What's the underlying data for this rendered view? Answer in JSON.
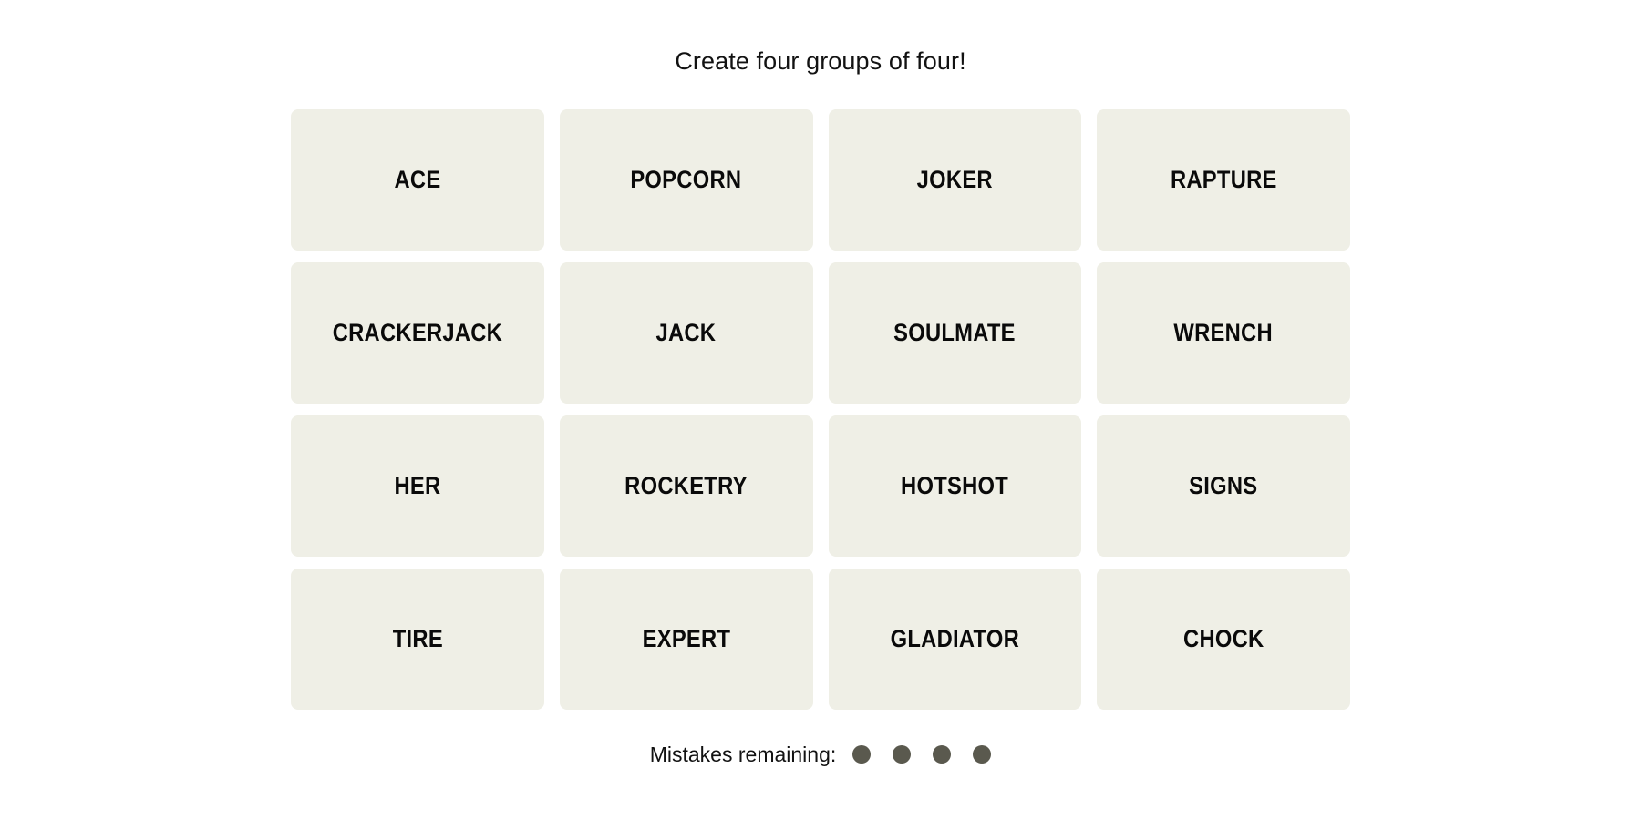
{
  "game": {
    "instruction": "Create four groups of four!",
    "tile_bg_color": "#EFEFE6",
    "tile_text_color": "#0A0A0A",
    "page_bg_color": "#FFFFFF",
    "grid": {
      "rows": 4,
      "columns": 4,
      "tiles": [
        {
          "label": "ACE"
        },
        {
          "label": "POPCORN"
        },
        {
          "label": "JOKER"
        },
        {
          "label": "RAPTURE"
        },
        {
          "label": "CRACKERJACK"
        },
        {
          "label": "JACK"
        },
        {
          "label": "SOULMATE"
        },
        {
          "label": "WRENCH"
        },
        {
          "label": "HER"
        },
        {
          "label": "ROCKETRY"
        },
        {
          "label": "HOTSHOT"
        },
        {
          "label": "SIGNS"
        },
        {
          "label": "TIRE"
        },
        {
          "label": "EXPERT"
        },
        {
          "label": "GLADIATOR"
        },
        {
          "label": "CHOCK"
        }
      ]
    },
    "mistakes": {
      "label": "Mistakes remaining:",
      "remaining": 4,
      "dot_color": "#5A594E",
      "dots": [
        {
          "filled": true
        },
        {
          "filled": true
        },
        {
          "filled": true
        },
        {
          "filled": true
        }
      ]
    }
  }
}
